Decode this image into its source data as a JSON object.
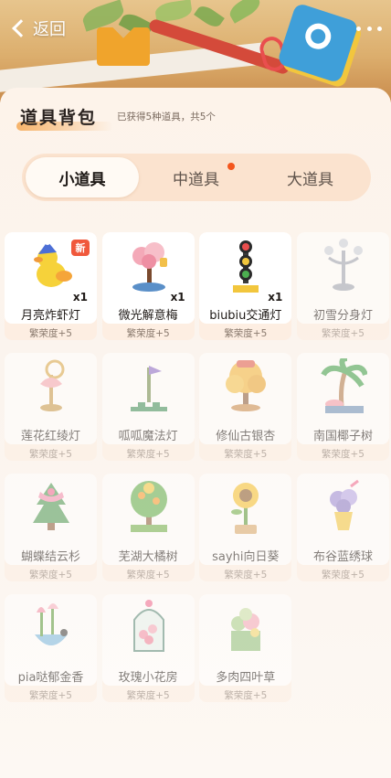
{
  "nav": {
    "back_label": "返回"
  },
  "header": {
    "title": "道具背包",
    "subtitle": "已获得5种道具，共5个"
  },
  "tabs": [
    {
      "label": "小道具",
      "active": true,
      "has_dot": false
    },
    {
      "label": "中道具",
      "active": false,
      "has_dot": true
    },
    {
      "label": "大道具",
      "active": false,
      "has_dot": false
    }
  ],
  "items": [
    {
      "name": "月亮炸虾灯",
      "count": "x1",
      "prosperity": "繁荣度+5",
      "owned": true,
      "new_badge": "新",
      "icon": "duck-lamp-icon"
    },
    {
      "name": "微光解意梅",
      "count": "x1",
      "prosperity": "繁荣度+5",
      "owned": true,
      "icon": "plum-tree-icon"
    },
    {
      "name": "biubiu交通灯",
      "count": "x1",
      "prosperity": "繁荣度+5",
      "owned": true,
      "icon": "traffic-light-icon"
    },
    {
      "name": "初雪分身灯",
      "prosperity": "繁荣度+5",
      "owned": false,
      "icon": "candelabra-icon"
    },
    {
      "name": "莲花红绫灯",
      "prosperity": "繁荣度+5",
      "owned": false,
      "icon": "lotus-lamp-icon"
    },
    {
      "name": "呱呱魔法灯",
      "prosperity": "繁荣度+5",
      "owned": false,
      "icon": "magic-lamp-icon"
    },
    {
      "name": "修仙古银杏",
      "prosperity": "繁荣度+5",
      "owned": false,
      "icon": "ginkgo-tree-icon"
    },
    {
      "name": "南国椰子树",
      "prosperity": "繁荣度+5",
      "owned": false,
      "icon": "palm-tree-icon"
    },
    {
      "name": "蝴蝶结云杉",
      "prosperity": "繁荣度+5",
      "owned": false,
      "icon": "spruce-tree-icon"
    },
    {
      "name": "芜湖大橘树",
      "prosperity": "繁荣度+5",
      "owned": false,
      "icon": "orange-tree-icon"
    },
    {
      "name": "sayhi向日葵",
      "prosperity": "繁荣度+5",
      "owned": false,
      "icon": "sunflower-icon"
    },
    {
      "name": "布谷蓝绣球",
      "prosperity": "繁荣度+5",
      "owned": false,
      "icon": "hydrangea-icon"
    },
    {
      "name": "pia哒郁金香",
      "prosperity": "繁荣度+5",
      "owned": false,
      "icon": "tulip-icon"
    },
    {
      "name": "玫瑰小花房",
      "prosperity": "繁荣度+5",
      "owned": false,
      "icon": "rose-greenhouse-icon"
    },
    {
      "name": "多肉四叶草",
      "prosperity": "繁荣度+5",
      "owned": false,
      "icon": "succulent-icon"
    }
  ],
  "colors": {
    "accent": "#f4561d",
    "new_badge": "#f0583c",
    "tab_bar": "#fbe3cf",
    "page_bg": "#fdf6ee"
  }
}
